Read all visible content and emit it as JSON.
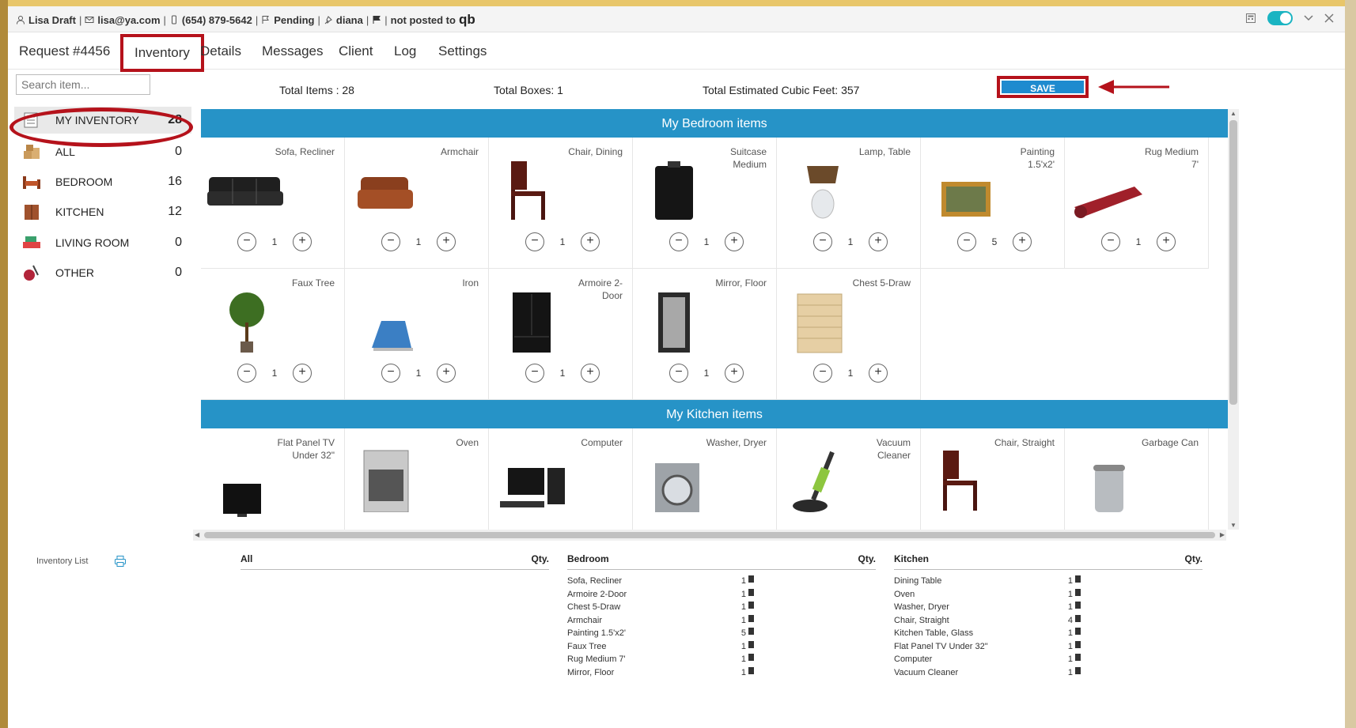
{
  "infobar": {
    "name": "Lisa Draft",
    "email": "lisa@ya.com",
    "phone": "(654) 879-5642",
    "status": "Pending",
    "assignee": "diana",
    "posted": "not posted to",
    "qb": "qb"
  },
  "tabs": [
    {
      "label": "Request #4456"
    },
    {
      "label": "Inventory"
    },
    {
      "label": "Details"
    },
    {
      "label": "Messages"
    },
    {
      "label": "Client"
    },
    {
      "label": "Log"
    },
    {
      "label": "Settings"
    }
  ],
  "search": {
    "placeholder": "Search item..."
  },
  "categories": [
    {
      "label": "MY INVENTORY",
      "count": "28"
    },
    {
      "label": "ALL",
      "count": "0"
    },
    {
      "label": "BEDROOM",
      "count": "16"
    },
    {
      "label": "KITCHEN",
      "count": "12"
    },
    {
      "label": "LIVING ROOM",
      "count": "0"
    },
    {
      "label": "OTHER",
      "count": "0"
    }
  ],
  "totals": {
    "items": "Total Items : 28",
    "boxes": "Total Boxes: 1",
    "cubic": "Total Estimated Cubic Feet: 357"
  },
  "save_label": "SAVE INVENTORY",
  "sections": [
    {
      "title": "My Bedroom items",
      "rows": [
        [
          {
            "name": "Sofa, Recliner",
            "qty": "1",
            "icon": "sofa"
          },
          {
            "name": "Armchair",
            "qty": "1",
            "icon": "armchair"
          },
          {
            "name": "Chair, Dining",
            "qty": "1",
            "icon": "chair"
          },
          {
            "name": "Suitcase Medium",
            "qty": "1",
            "icon": "suitcase"
          },
          {
            "name": "Lamp, Table",
            "qty": "1",
            "icon": "lamp"
          },
          {
            "name": "Painting 1.5'x2'",
            "qty": "5",
            "icon": "painting"
          },
          {
            "name": "Rug Medium 7'",
            "qty": "1",
            "icon": "rug"
          }
        ],
        [
          {
            "name": "Faux Tree",
            "qty": "1",
            "icon": "tree"
          },
          {
            "name": "Iron",
            "qty": "1",
            "icon": "iron"
          },
          {
            "name": "Armoire 2-Door",
            "qty": "1",
            "icon": "armoire"
          },
          {
            "name": "Mirror, Floor",
            "qty": "1",
            "icon": "mirror"
          },
          {
            "name": "Chest 5-Draw",
            "qty": "1",
            "icon": "chest"
          }
        ]
      ]
    },
    {
      "title": "My Kitchen items",
      "rows": [
        [
          {
            "name": "Flat Panel TV Under 32\"",
            "qty": "",
            "icon": "tv"
          },
          {
            "name": "Oven",
            "qty": "",
            "icon": "oven"
          },
          {
            "name": "Computer",
            "qty": "",
            "icon": "computer"
          },
          {
            "name": "Washer, Dryer",
            "qty": "",
            "icon": "washer"
          },
          {
            "name": "Vacuum Cleaner",
            "qty": "",
            "icon": "vacuum"
          },
          {
            "name": "Chair, Straight",
            "qty": "",
            "icon": "chair"
          },
          {
            "name": "Garbage Can",
            "qty": "",
            "icon": "garbage"
          }
        ]
      ]
    }
  ],
  "list": {
    "label": "Inventory List",
    "qty_header": "Qty.",
    "columns": [
      {
        "title": "All",
        "items": []
      },
      {
        "title": "Bedroom",
        "items": [
          {
            "name": "Sofa, Recliner",
            "qty": "1"
          },
          {
            "name": "Armoire 2-Door",
            "qty": "1"
          },
          {
            "name": "Chest 5-Draw",
            "qty": "1"
          },
          {
            "name": "Armchair",
            "qty": "1"
          },
          {
            "name": "Painting 1.5'x2'",
            "qty": "5"
          },
          {
            "name": "Faux Tree",
            "qty": "1"
          },
          {
            "name": "Rug Medium 7'",
            "qty": "1"
          },
          {
            "name": "Mirror, Floor",
            "qty": "1"
          }
        ]
      },
      {
        "title": "Kitchen",
        "items": [
          {
            "name": "Dining Table",
            "qty": "1"
          },
          {
            "name": "Oven",
            "qty": "1"
          },
          {
            "name": "Washer, Dryer",
            "qty": "1"
          },
          {
            "name": "Chair, Straight",
            "qty": "4"
          },
          {
            "name": "Kitchen Table, Glass",
            "qty": "1"
          },
          {
            "name": "Flat Panel TV Under 32\"",
            "qty": "1"
          },
          {
            "name": "Computer",
            "qty": "1"
          },
          {
            "name": "Vacuum Cleaner",
            "qty": "1"
          }
        ]
      }
    ]
  },
  "colors": {
    "accent": "#2693c7",
    "highlight": "#b5121b",
    "toggle": "#1ab4c2"
  }
}
